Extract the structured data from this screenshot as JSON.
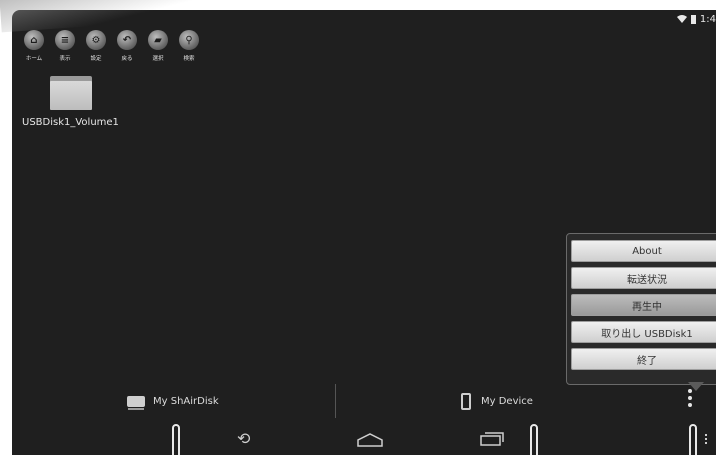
{
  "status": {
    "time": "1:4"
  },
  "toolbar": {
    "items": [
      {
        "label": "ホーム",
        "icon": "home-icon"
      },
      {
        "label": "表示",
        "icon": "list-icon"
      },
      {
        "label": "設定",
        "icon": "gear-icon"
      },
      {
        "label": "戻る",
        "icon": "back-arrow-icon"
      },
      {
        "label": "選択",
        "icon": "folder-open-icon"
      },
      {
        "label": "検索",
        "icon": "search-icon"
      }
    ]
  },
  "files": [
    {
      "name": "USBDisk1_Volume1",
      "icon": "folder-icon"
    }
  ],
  "menu": {
    "items": [
      {
        "label": "About"
      },
      {
        "label": "転送状況"
      },
      {
        "label": "再生中"
      },
      {
        "label": "取り出し USBDisk1"
      },
      {
        "label": "終了"
      }
    ],
    "active_index": 2
  },
  "tabs": {
    "shairdisk": "My ShAirDisk",
    "device": "My Device"
  },
  "colors": {
    "background": "#1f1f1f",
    "menu_button": "#e6e6e6",
    "menu_button_active": "#ababab",
    "text": "#e6e6e6"
  }
}
